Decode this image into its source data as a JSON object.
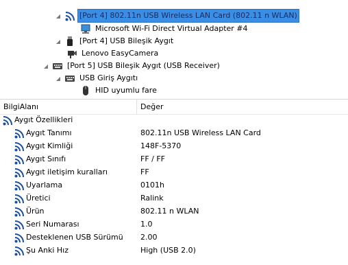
{
  "tree": {
    "nodes": [
      {
        "label": "[Port 4] 802.11n USB Wireless LAN Card (802.11 n WLAN)",
        "icon": "wifi-icon",
        "selected": true
      },
      {
        "label": "Microsoft Wi-Fi Direct Virtual Adapter #4",
        "icon": "network-adapter-icon"
      },
      {
        "label": "[Port 4] USB Bileşik Aygıt",
        "icon": "usb-stick-icon"
      },
      {
        "label": "Lenovo EasyCamera",
        "icon": "camera-icon"
      },
      {
        "label": "[Port 5] USB Bileşik Aygıt (USB Receiver)",
        "icon": "keyboard-icon"
      },
      {
        "label": "USB Giriş Aygıtı",
        "icon": "keyboard-icon"
      },
      {
        "label": "HID uyumlu fare",
        "icon": "mouse-icon"
      }
    ]
  },
  "grid": {
    "header": {
      "col1": "BilgiAlanı",
      "col2": "Değer"
    },
    "group": "Aygıt Özellikleri",
    "rows": [
      {
        "name": "Aygıt Tanımı",
        "value": "802.11n USB Wireless LAN Card"
      },
      {
        "name": "Aygıt Kimliği",
        "value": "148F-5370"
      },
      {
        "name": "Aygıt Sınıfı",
        "value": "FF / FF"
      },
      {
        "name": "Aygıt iletişim kuralları",
        "value": "FF"
      },
      {
        "name": "Uyarlama",
        "value": "0101h"
      },
      {
        "name": "Üretici",
        "value": "Ralink"
      },
      {
        "name": "Ürün",
        "value": "802.11 n WLAN"
      },
      {
        "name": "Seri Numarası",
        "value": "1.0"
      },
      {
        "name": "Desteklenen USB Sürümü",
        "value": "2.00"
      },
      {
        "name": "Şu Anki Hız",
        "value": "High  (USB 2.0)"
      }
    ]
  },
  "colors": {
    "selection": "#3a8ee6",
    "wifi_icon": "#1a4f9c"
  }
}
